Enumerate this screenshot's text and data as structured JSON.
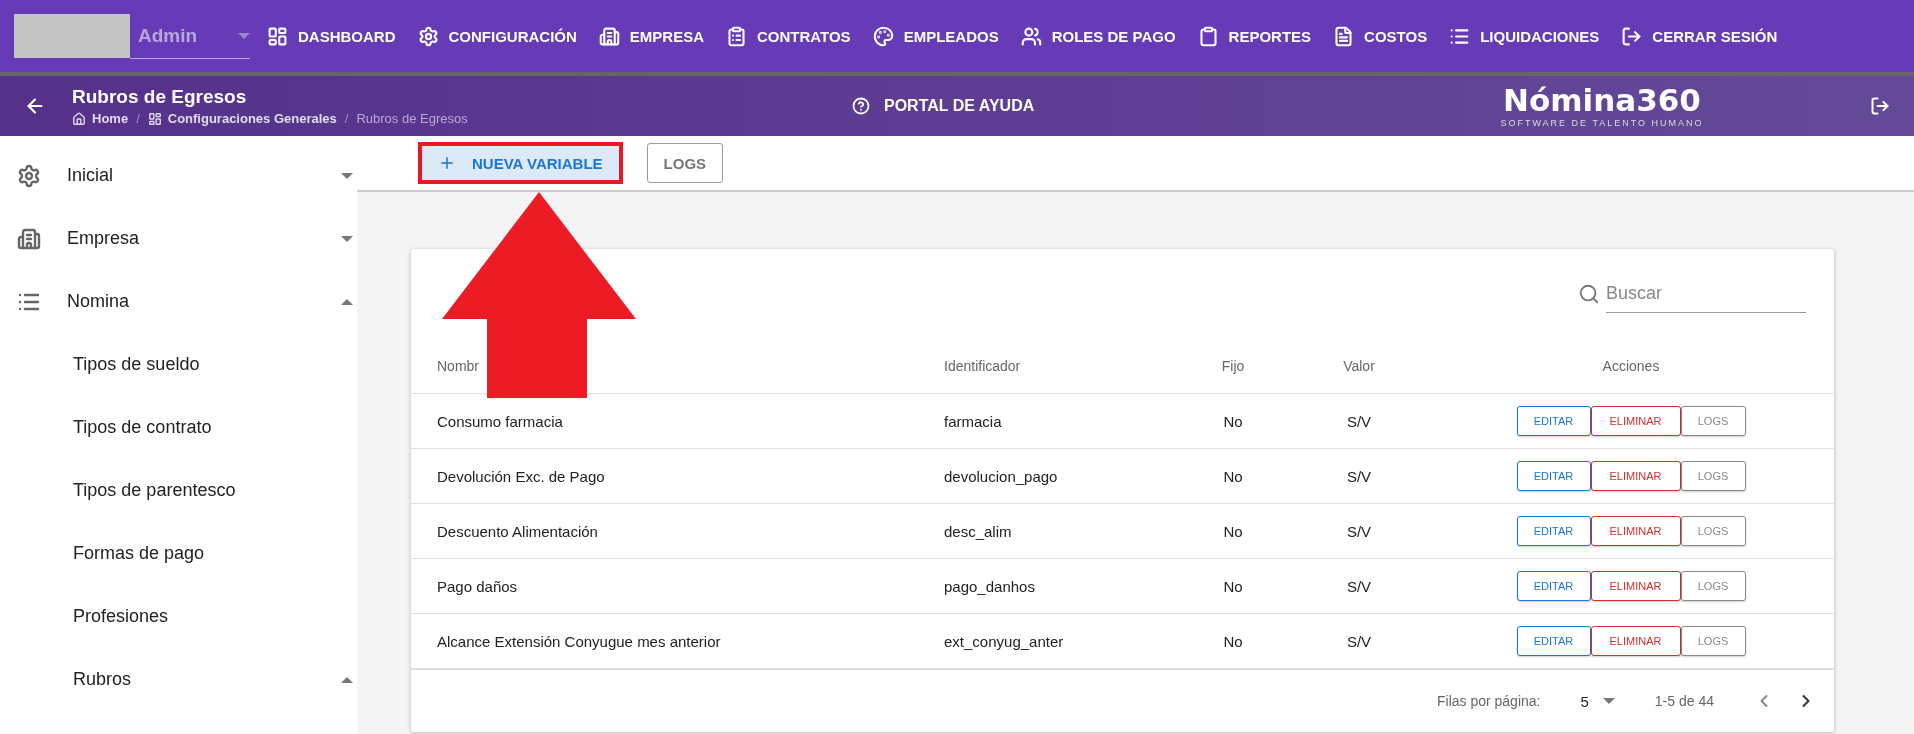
{
  "nav": {
    "user": "Admin",
    "items": [
      {
        "label": "DASHBOARD"
      },
      {
        "label": "CONFIGURACIÓN"
      },
      {
        "label": "EMPRESA"
      },
      {
        "label": "CONTRATOS"
      },
      {
        "label": "EMPLEADOS"
      },
      {
        "label": "ROLES DE PAGO"
      },
      {
        "label": "REPORTES"
      },
      {
        "label": "COSTOS"
      },
      {
        "label": "LIQUIDACIONES"
      },
      {
        "label": "CERRAR SESIÓN"
      }
    ]
  },
  "header": {
    "title": "Rubros de Egresos",
    "breadcrumb": [
      {
        "label": "Home",
        "current": false
      },
      {
        "label": "Configuraciones Generales",
        "current": false,
        "separator": "/"
      },
      {
        "label": "Rubros de Egresos",
        "current": true,
        "separator": "/"
      }
    ],
    "help": "PORTAL DE AYUDA",
    "logo": {
      "name": "Nómina360",
      "tagline": "SOFTWARE DE TALENTO HUMANO"
    }
  },
  "sidebar": {
    "items": [
      {
        "label": "Inicial",
        "expanded": false
      },
      {
        "label": "Empresa",
        "expanded": false
      },
      {
        "label": "Nomina",
        "expanded": true,
        "children": [
          {
            "label": "Tipos de sueldo"
          },
          {
            "label": "Tipos de contrato"
          },
          {
            "label": "Tipos de parentesco"
          },
          {
            "label": "Formas de pago"
          },
          {
            "label": "Profesiones"
          },
          {
            "label": "Rubros",
            "expanded": true
          }
        ]
      }
    ]
  },
  "toolbar": {
    "buttons": [
      {
        "label": "NUEVA VARIABLE",
        "kind": "primary"
      },
      {
        "label": "LOGS",
        "kind": "outline"
      }
    ]
  },
  "table": {
    "search": {
      "placeholder": "Buscar"
    },
    "columns": [
      "Nombr",
      "Identificador",
      "Fijo",
      "Valor",
      "Acciones"
    ],
    "rows": [
      {
        "cells": [
          "Consumo farmacia",
          "farmacia",
          "No",
          "S/V"
        ],
        "actions": [
          {
            "label": "EDITAR",
            "kind": "edit"
          },
          {
            "label": "ELIMINAR",
            "kind": "delete"
          },
          {
            "label": "LOGS",
            "kind": "logs"
          }
        ]
      },
      {
        "cells": [
          "Devolución Exc. de Pago",
          "devolucion_pago",
          "No",
          "S/V"
        ],
        "actions": [
          {
            "label": "EDITAR",
            "kind": "edit"
          },
          {
            "label": "ELIMINAR",
            "kind": "delete"
          },
          {
            "label": "LOGS",
            "kind": "logs"
          }
        ]
      },
      {
        "cells": [
          "Descuento Alimentación",
          "desc_alim",
          "No",
          "S/V"
        ],
        "actions": [
          {
            "label": "EDITAR",
            "kind": "edit"
          },
          {
            "label": "ELIMINAR",
            "kind": "delete"
          },
          {
            "label": "LOGS",
            "kind": "logs"
          }
        ]
      },
      {
        "cells": [
          "Pago daños",
          "pago_danhos",
          "No",
          "S/V"
        ],
        "actions": [
          {
            "label": "EDITAR",
            "kind": "edit"
          },
          {
            "label": "ELIMINAR",
            "kind": "delete"
          },
          {
            "label": "LOGS",
            "kind": "logs"
          }
        ]
      },
      {
        "cells": [
          "Alcance Extensión Conyugue mes anterior",
          "ext_conyug_anter",
          "No",
          "S/V"
        ],
        "actions": [
          {
            "label": "EDITAR",
            "kind": "edit"
          },
          {
            "label": "ELIMINAR",
            "kind": "delete"
          },
          {
            "label": "LOGS",
            "kind": "logs"
          }
        ]
      }
    ],
    "footer": {
      "rows_label": "Filas por página:",
      "rows_per_page": "5",
      "range": "1-5 de 44"
    }
  }
}
